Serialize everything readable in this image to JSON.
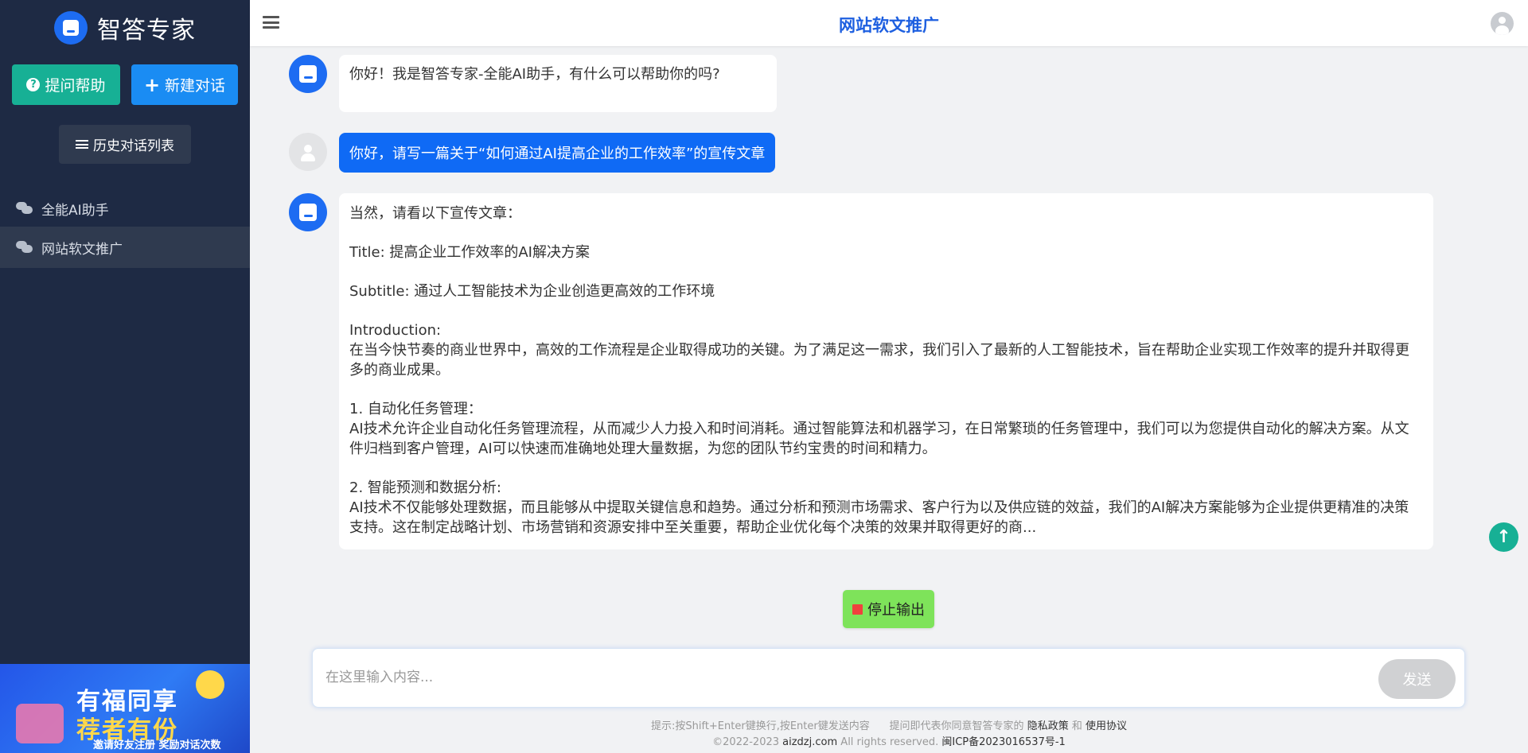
{
  "brand": {
    "name": "智答专家"
  },
  "sidebar": {
    "help_button": "提问帮助",
    "new_chat_button": "新建对话",
    "history_button": "历史对话列表",
    "items": [
      {
        "label": "全能AI助手"
      },
      {
        "label": "网站软文推广",
        "active": true
      }
    ],
    "promo": {
      "line1": "有福同享",
      "line2": "荐者有份",
      "subtitle": "邀请好友注册 奖励对话次数"
    }
  },
  "header": {
    "title": "网站软文推广"
  },
  "messages": [
    {
      "role": "bot",
      "text": "你好！我是智答专家-全能AI助手，有什么可以帮助你的吗?"
    },
    {
      "role": "user",
      "text": "你好，请写一篇关于“如何通过AI提高企业的工作效率”的宣传文章"
    },
    {
      "role": "bot",
      "paragraphs": [
        "当然，请看以下宣传文章：",
        "Title: 提高企业工作效率的AI解决方案",
        "Subtitle: 通过人工智能技术为企业创造更高效的工作环境",
        "Introduction:\n在当今快节奏的商业世界中，高效的工作流程是企业取得成功的关键。为了满足这一需求，我们引入了最新的人工智能技术，旨在帮助企业实现工作效率的提升并取得更多的商业成果。",
        "1. 自动化任务管理：\nAI技术允许企业自动化任务管理流程，从而减少人力投入和时间消耗。通过智能算法和机器学习，在日常繁琐的任务管理中，我们可以为您提供自动化的解决方案。从文件归档到客户管理，AI可以快速而准确地处理大量数据，为您的团队节约宝贵的时间和精力。",
        "2. 智能预测和数据分析:\nAI技术不仅能够处理数据，而且能够从中提取关键信息和趋势。通过分析和预测市场需求、客户行为以及供应链的效益，我们的AI解决方案能够为企业提供更精准的决策支持。这在制定战略计划、市场营销和资源安排中至关重要，帮助企业优化每个决策的效果并取得更好的商..."
      ]
    }
  ],
  "controls": {
    "stop_button": "停止输出",
    "input_placeholder": "在这里输入内容...",
    "send_button": "发送"
  },
  "footer": {
    "hint": "提示:按Shift+Enter键换行,按Enter键发送内容",
    "agree_prefix": "提问即代表你同意智答专家的",
    "privacy_link": "隐私政策",
    "and": "和",
    "terms_link": "使用协议",
    "copyright_prefix": "©2022-2023",
    "domain_link": "aizdzj.com",
    "rights": "All rights reserved.",
    "icp_link": "闽ICP备2023016537号-1"
  }
}
